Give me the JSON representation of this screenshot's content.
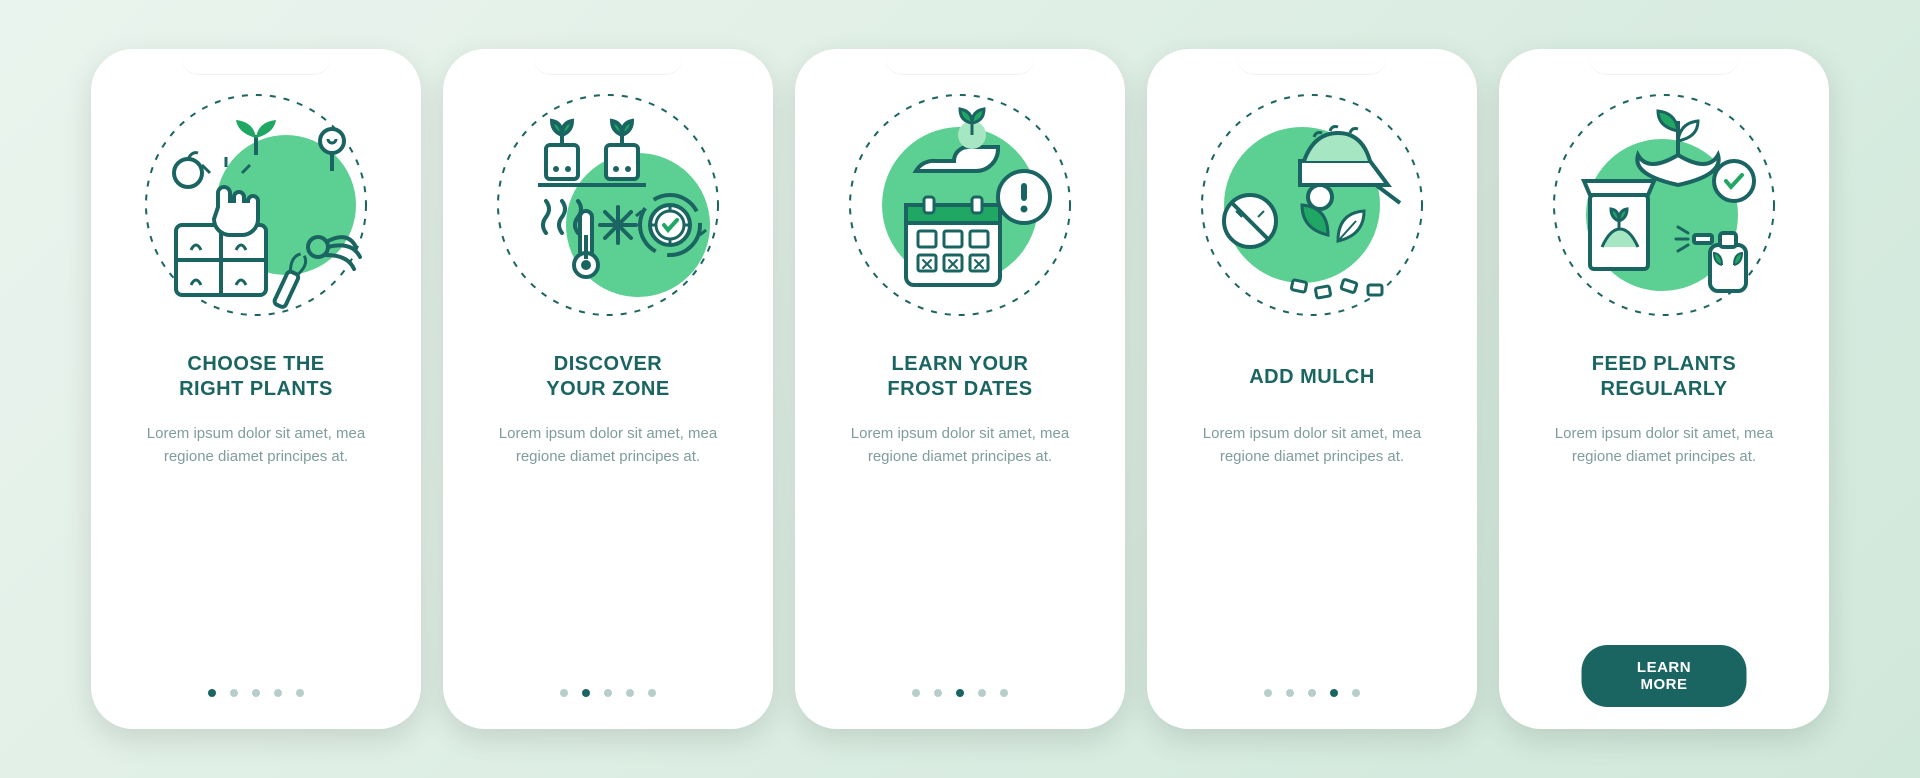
{
  "body_text": "Lorem ipsum dolor sit amet, mea regione diamet principes at.",
  "cta_label": "LEARN MORE",
  "total_screens": 5,
  "screens": [
    {
      "title": "CHOOSE THE\nRIGHT PLANTS",
      "icon": "choose-plants"
    },
    {
      "title": "DISCOVER\nYOUR ZONE",
      "icon": "discover-zone"
    },
    {
      "title": "LEARN YOUR\nFROST DATES",
      "icon": "frost-dates"
    },
    {
      "title": "ADD MULCH",
      "icon": "add-mulch"
    },
    {
      "title": "FEED PLANTS\nREGULARLY",
      "icon": "feed-plants"
    }
  ]
}
